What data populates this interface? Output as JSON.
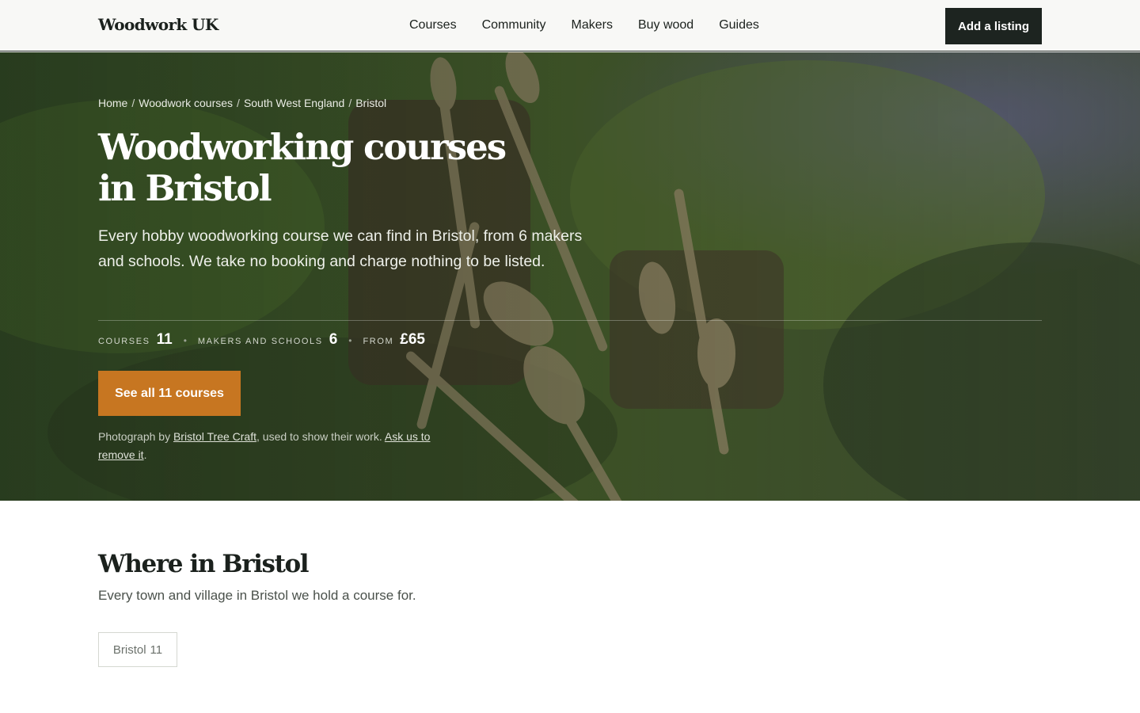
{
  "header": {
    "logo": "Woodwork UK",
    "nav": [
      "Courses",
      "Community",
      "Makers",
      "Buy wood",
      "Guides"
    ],
    "cta": "Add a listing"
  },
  "hero": {
    "breadcrumb": [
      "Home",
      "Woodwork courses",
      "South West England",
      "Bristol"
    ],
    "breadcrumb_separator": "/",
    "title": "Woodworking courses in Bristol",
    "lede": "Every hobby woodworking course we can find in Bristol, from 6 makers and schools. We take no booking and charge nothing to be listed.",
    "stats": [
      {
        "label": "COURSES",
        "value": "11"
      },
      {
        "label": "MAKERS AND SCHOOLS",
        "value": "6"
      },
      {
        "label": "FROM",
        "value": "£65"
      }
    ],
    "cta": "See all 11 courses",
    "credit": {
      "prefix": "Photograph by ",
      "author": "Bristol Tree Craft",
      "middle": ", used to show their work. ",
      "remove_link": "Ask us to remove it",
      "suffix": "."
    },
    "colors": {
      "cta": "#c77621",
      "overlay": "#142016"
    }
  },
  "where": {
    "title": "Where in Bristol",
    "subtitle": "Every town and village in Bristol we hold a course for.",
    "towns": [
      {
        "name": "Bristol",
        "count": "11"
      }
    ]
  }
}
